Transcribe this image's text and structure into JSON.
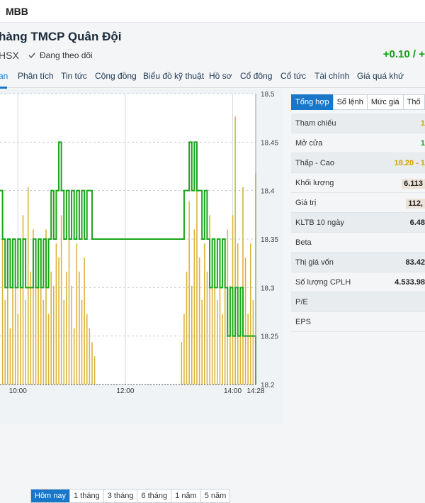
{
  "header": {
    "ticker": "MBB",
    "company": "hàng TMCP Quân Đội",
    "exchange": "HSX",
    "follow_label": "Đang theo dõi",
    "change": "+0.10 / +"
  },
  "tabs": [
    {
      "label": "an"
    },
    {
      "label": "Phân tích"
    },
    {
      "label": "Tin tức"
    },
    {
      "label": "Cộng đồng"
    },
    {
      "label": "Biểu đồ kỹ thuật"
    },
    {
      "label": "Hồ sơ"
    },
    {
      "label": "Cổ đông"
    },
    {
      "label": "Cổ tức"
    },
    {
      "label": "Tài chính"
    },
    {
      "label": "Giá quá khứ"
    }
  ],
  "chart_data": {
    "type": "line",
    "x_ticks": [
      "10:00",
      "12:00",
      "14:00",
      "14:28"
    ],
    "y_ticks": [
      "18.5",
      "18.45",
      "18.4",
      "18.35",
      "18.3",
      "18.25",
      "18.2"
    ],
    "ylim": [
      18.2,
      18.5
    ],
    "grid": true,
    "price_color": "#19a519",
    "volume_color": "#d9b43b",
    "price_points": [
      [
        0.0,
        18.4
      ],
      [
        0.01,
        18.35
      ],
      [
        0.02,
        18.3
      ],
      [
        0.03,
        18.35
      ],
      [
        0.04,
        18.3
      ],
      [
        0.05,
        18.35
      ],
      [
        0.06,
        18.3
      ],
      [
        0.07,
        18.35
      ],
      [
        0.08,
        18.3
      ],
      [
        0.09,
        18.35
      ],
      [
        0.1,
        18.3
      ],
      [
        0.12,
        18.3
      ],
      [
        0.13,
        18.35
      ],
      [
        0.14,
        18.3
      ],
      [
        0.15,
        18.35
      ],
      [
        0.16,
        18.3
      ],
      [
        0.17,
        18.35
      ],
      [
        0.18,
        18.3
      ],
      [
        0.19,
        18.35
      ],
      [
        0.2,
        18.4
      ],
      [
        0.21,
        18.35
      ],
      [
        0.22,
        18.4
      ],
      [
        0.23,
        18.45
      ],
      [
        0.24,
        18.4
      ],
      [
        0.25,
        18.35
      ],
      [
        0.26,
        18.4
      ],
      [
        0.27,
        18.35
      ],
      [
        0.28,
        18.4
      ],
      [
        0.29,
        18.35
      ],
      [
        0.3,
        18.4
      ],
      [
        0.31,
        18.35
      ],
      [
        0.32,
        18.4
      ],
      [
        0.33,
        18.35
      ],
      [
        0.34,
        18.4
      ],
      [
        0.36,
        18.35
      ],
      [
        0.46,
        18.35
      ],
      [
        0.7,
        18.35
      ],
      [
        0.72,
        18.4
      ],
      [
        0.74,
        18.45
      ],
      [
        0.75,
        18.4
      ],
      [
        0.76,
        18.45
      ],
      [
        0.77,
        18.4
      ],
      [
        0.78,
        18.4
      ],
      [
        0.79,
        18.35
      ],
      [
        0.8,
        18.4
      ],
      [
        0.81,
        18.35
      ],
      [
        0.82,
        18.3
      ],
      [
        0.83,
        18.35
      ],
      [
        0.84,
        18.3
      ],
      [
        0.85,
        18.35
      ],
      [
        0.86,
        18.3
      ],
      [
        0.87,
        18.35
      ],
      [
        0.88,
        18.3
      ],
      [
        0.89,
        18.25
      ],
      [
        0.9,
        18.3
      ],
      [
        0.91,
        18.25
      ],
      [
        0.92,
        18.3
      ],
      [
        0.93,
        18.25
      ],
      [
        0.94,
        18.3
      ],
      [
        0.95,
        18.25
      ],
      [
        0.99,
        18.25
      ],
      [
        1.0,
        18.2
      ]
    ],
    "volume_bars": [
      [
        0.01,
        0.55
      ],
      [
        0.02,
        0.3
      ],
      [
        0.03,
        0.4
      ],
      [
        0.04,
        0.2
      ],
      [
        0.05,
        0.5
      ],
      [
        0.06,
        0.35
      ],
      [
        0.07,
        0.25
      ],
      [
        0.08,
        0.45
      ],
      [
        0.09,
        0.6
      ],
      [
        0.1,
        0.3
      ],
      [
        0.11,
        0.7
      ],
      [
        0.12,
        0.4
      ],
      [
        0.13,
        0.55
      ],
      [
        0.14,
        0.35
      ],
      [
        0.15,
        0.5
      ],
      [
        0.16,
        0.45
      ],
      [
        0.17,
        0.3
      ],
      [
        0.18,
        0.55
      ],
      [
        0.19,
        0.25
      ],
      [
        0.2,
        0.4
      ],
      [
        0.21,
        0.35
      ],
      [
        0.22,
        0.5
      ],
      [
        0.23,
        0.45
      ],
      [
        0.24,
        0.6
      ],
      [
        0.25,
        0.3
      ],
      [
        0.26,
        0.4
      ],
      [
        0.27,
        0.55
      ],
      [
        0.28,
        0.35
      ],
      [
        0.29,
        0.2
      ],
      [
        0.3,
        0.5
      ],
      [
        0.31,
        0.4
      ],
      [
        0.32,
        0.3
      ],
      [
        0.33,
        0.45
      ],
      [
        0.34,
        0.25
      ],
      [
        0.35,
        0.2
      ],
      [
        0.36,
        0.15
      ],
      [
        0.37,
        0.1
      ],
      [
        0.71,
        0.15
      ],
      [
        0.72,
        0.25
      ],
      [
        0.73,
        0.4
      ],
      [
        0.74,
        0.65
      ],
      [
        0.75,
        0.35
      ],
      [
        0.76,
        0.55
      ],
      [
        0.77,
        0.8
      ],
      [
        0.78,
        0.45
      ],
      [
        0.79,
        0.3
      ],
      [
        0.8,
        0.5
      ],
      [
        0.81,
        0.4
      ],
      [
        0.82,
        0.6
      ],
      [
        0.83,
        0.35
      ],
      [
        0.84,
        0.45
      ],
      [
        0.85,
        0.3
      ],
      [
        0.86,
        0.5
      ],
      [
        0.87,
        0.25
      ],
      [
        0.88,
        0.4
      ],
      [
        0.89,
        0.55
      ],
      [
        0.9,
        0.35
      ],
      [
        0.91,
        0.6
      ],
      [
        0.92,
        0.95
      ],
      [
        0.93,
        0.5
      ],
      [
        0.94,
        0.3
      ],
      [
        0.95,
        0.7
      ],
      [
        0.96,
        0.45
      ],
      [
        0.97,
        0.25
      ],
      [
        0.98,
        0.5
      ],
      [
        0.99,
        0.3
      ],
      [
        1.0,
        0.75
      ]
    ]
  },
  "range_buttons": [
    {
      "label": "Hôm nay"
    },
    {
      "label": "1 tháng"
    },
    {
      "label": "3 tháng"
    },
    {
      "label": "6 tháng"
    },
    {
      "label": "1 năm"
    },
    {
      "label": "5 năm"
    }
  ],
  "panel": {
    "tabs": [
      {
        "label": "Tổng hợp"
      },
      {
        "label": "Sổ lệnh"
      },
      {
        "label": "Mức giá"
      },
      {
        "label": "Thố"
      }
    ],
    "rows": [
      {
        "label": "Tham chiếu",
        "value": "1"
      },
      {
        "label": "Mở cửa",
        "value": "1"
      },
      {
        "label": "Thấp - Cao",
        "value": "18.20 - 1"
      },
      {
        "label": "Khối lượng",
        "value": "6.113"
      },
      {
        "label": "Giá trị",
        "value": "112,"
      },
      {
        "label": "KLTB 10 ngày",
        "value": "6.48"
      },
      {
        "label": "Beta",
        "value": ""
      },
      {
        "label": "Thị giá vốn",
        "value": "83.42"
      },
      {
        "label": "Số lượng CPLH",
        "value": "4.533.98"
      },
      {
        "label": "P/E",
        "value": ""
      },
      {
        "label": "EPS",
        "value": ""
      }
    ]
  }
}
